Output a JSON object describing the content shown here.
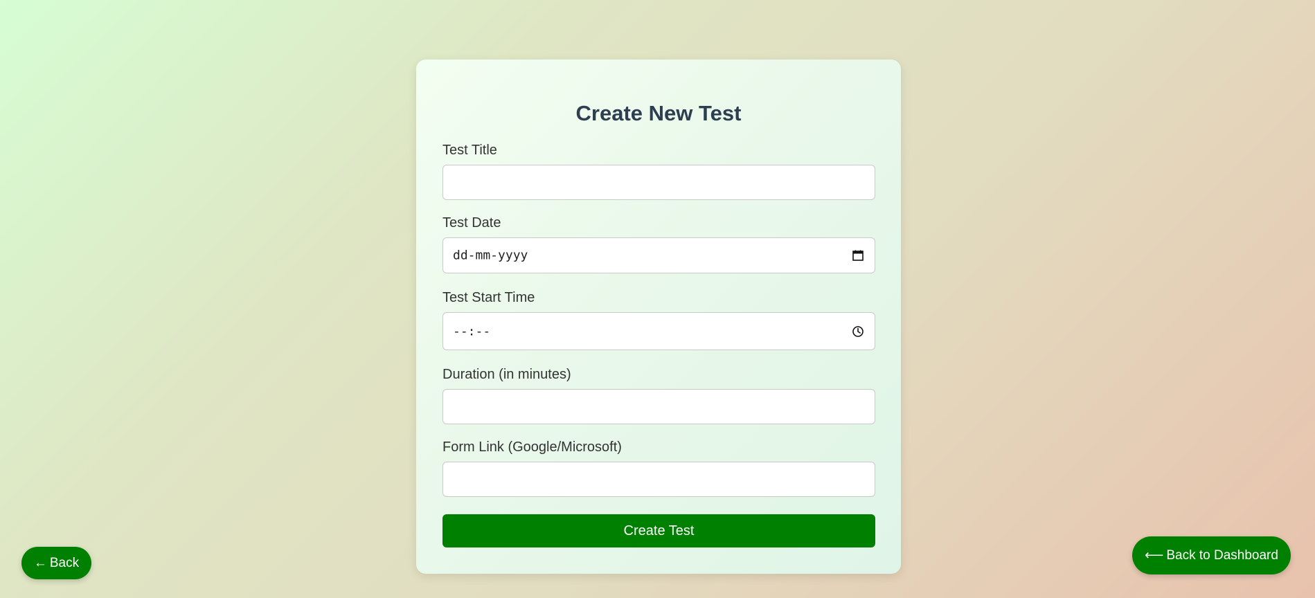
{
  "form": {
    "title": "Create New Test",
    "fields": {
      "title": {
        "label": "Test Title",
        "value": ""
      },
      "date": {
        "label": "Test Date",
        "placeholder": "dd-mm-yyyy"
      },
      "start_time": {
        "label": "Test Start Time",
        "placeholder": "--:--"
      },
      "duration": {
        "label": "Duration (in minutes)",
        "value": ""
      },
      "form_link": {
        "label": "Form Link (Google/Microsoft)",
        "value": ""
      }
    },
    "submit_label": "Create Test"
  },
  "nav": {
    "back_arrow": "←",
    "back_label": "Back",
    "dashboard_arrow": "⟵",
    "dashboard_label": "Back to Dashboard"
  },
  "icons": {
    "date": "calendar-icon",
    "time": "clock-icon",
    "back": "arrow-left-icon"
  },
  "colors": {
    "primary": "#008000",
    "title_text": "#2c3e50",
    "label_text": "#333333"
  }
}
